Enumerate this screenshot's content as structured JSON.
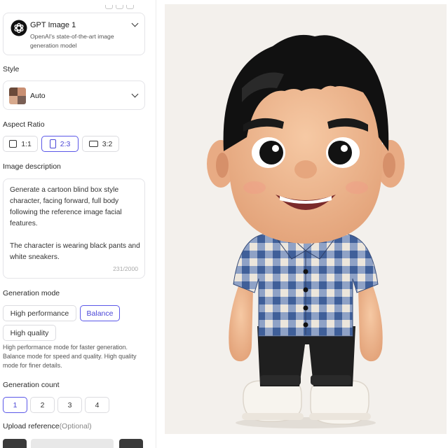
{
  "model": {
    "name": "GPT Image 1",
    "description": "OpenAI's state-of-the-art image generation model",
    "logo_icon": "openai-logo-icon"
  },
  "style": {
    "label": "Style",
    "value": "Auto"
  },
  "aspect_ratio": {
    "label": "Aspect Ratio",
    "options": [
      "1:1",
      "2:3",
      "3:2"
    ],
    "selected": "2:3"
  },
  "image_description": {
    "label": "Image description",
    "text": "Generate a cartoon blind box style character, facing forward, full body following the reference image facial features.\n\nThe character is wearing black pants and white sneakers.",
    "counter": "231/2000"
  },
  "generation_mode": {
    "label": "Generation mode",
    "options": [
      "High performance",
      "Balance",
      "High quality"
    ],
    "selected": "Balance",
    "helper": "High performance mode for faster generation. Balance mode for speed and quality. High quality mode for finer details."
  },
  "generation_count": {
    "label": "Generation count",
    "options": [
      "1",
      "2",
      "3",
      "4"
    ],
    "selected": "1"
  },
  "upload_reference": {
    "label": "Upload reference",
    "optional": "(Optional)"
  },
  "colors": {
    "accent": "#5b57e8",
    "canvas_bg": "#f3f0ec",
    "shirt_blue": "#4e6fa8",
    "pants": "#1e1e1e"
  }
}
